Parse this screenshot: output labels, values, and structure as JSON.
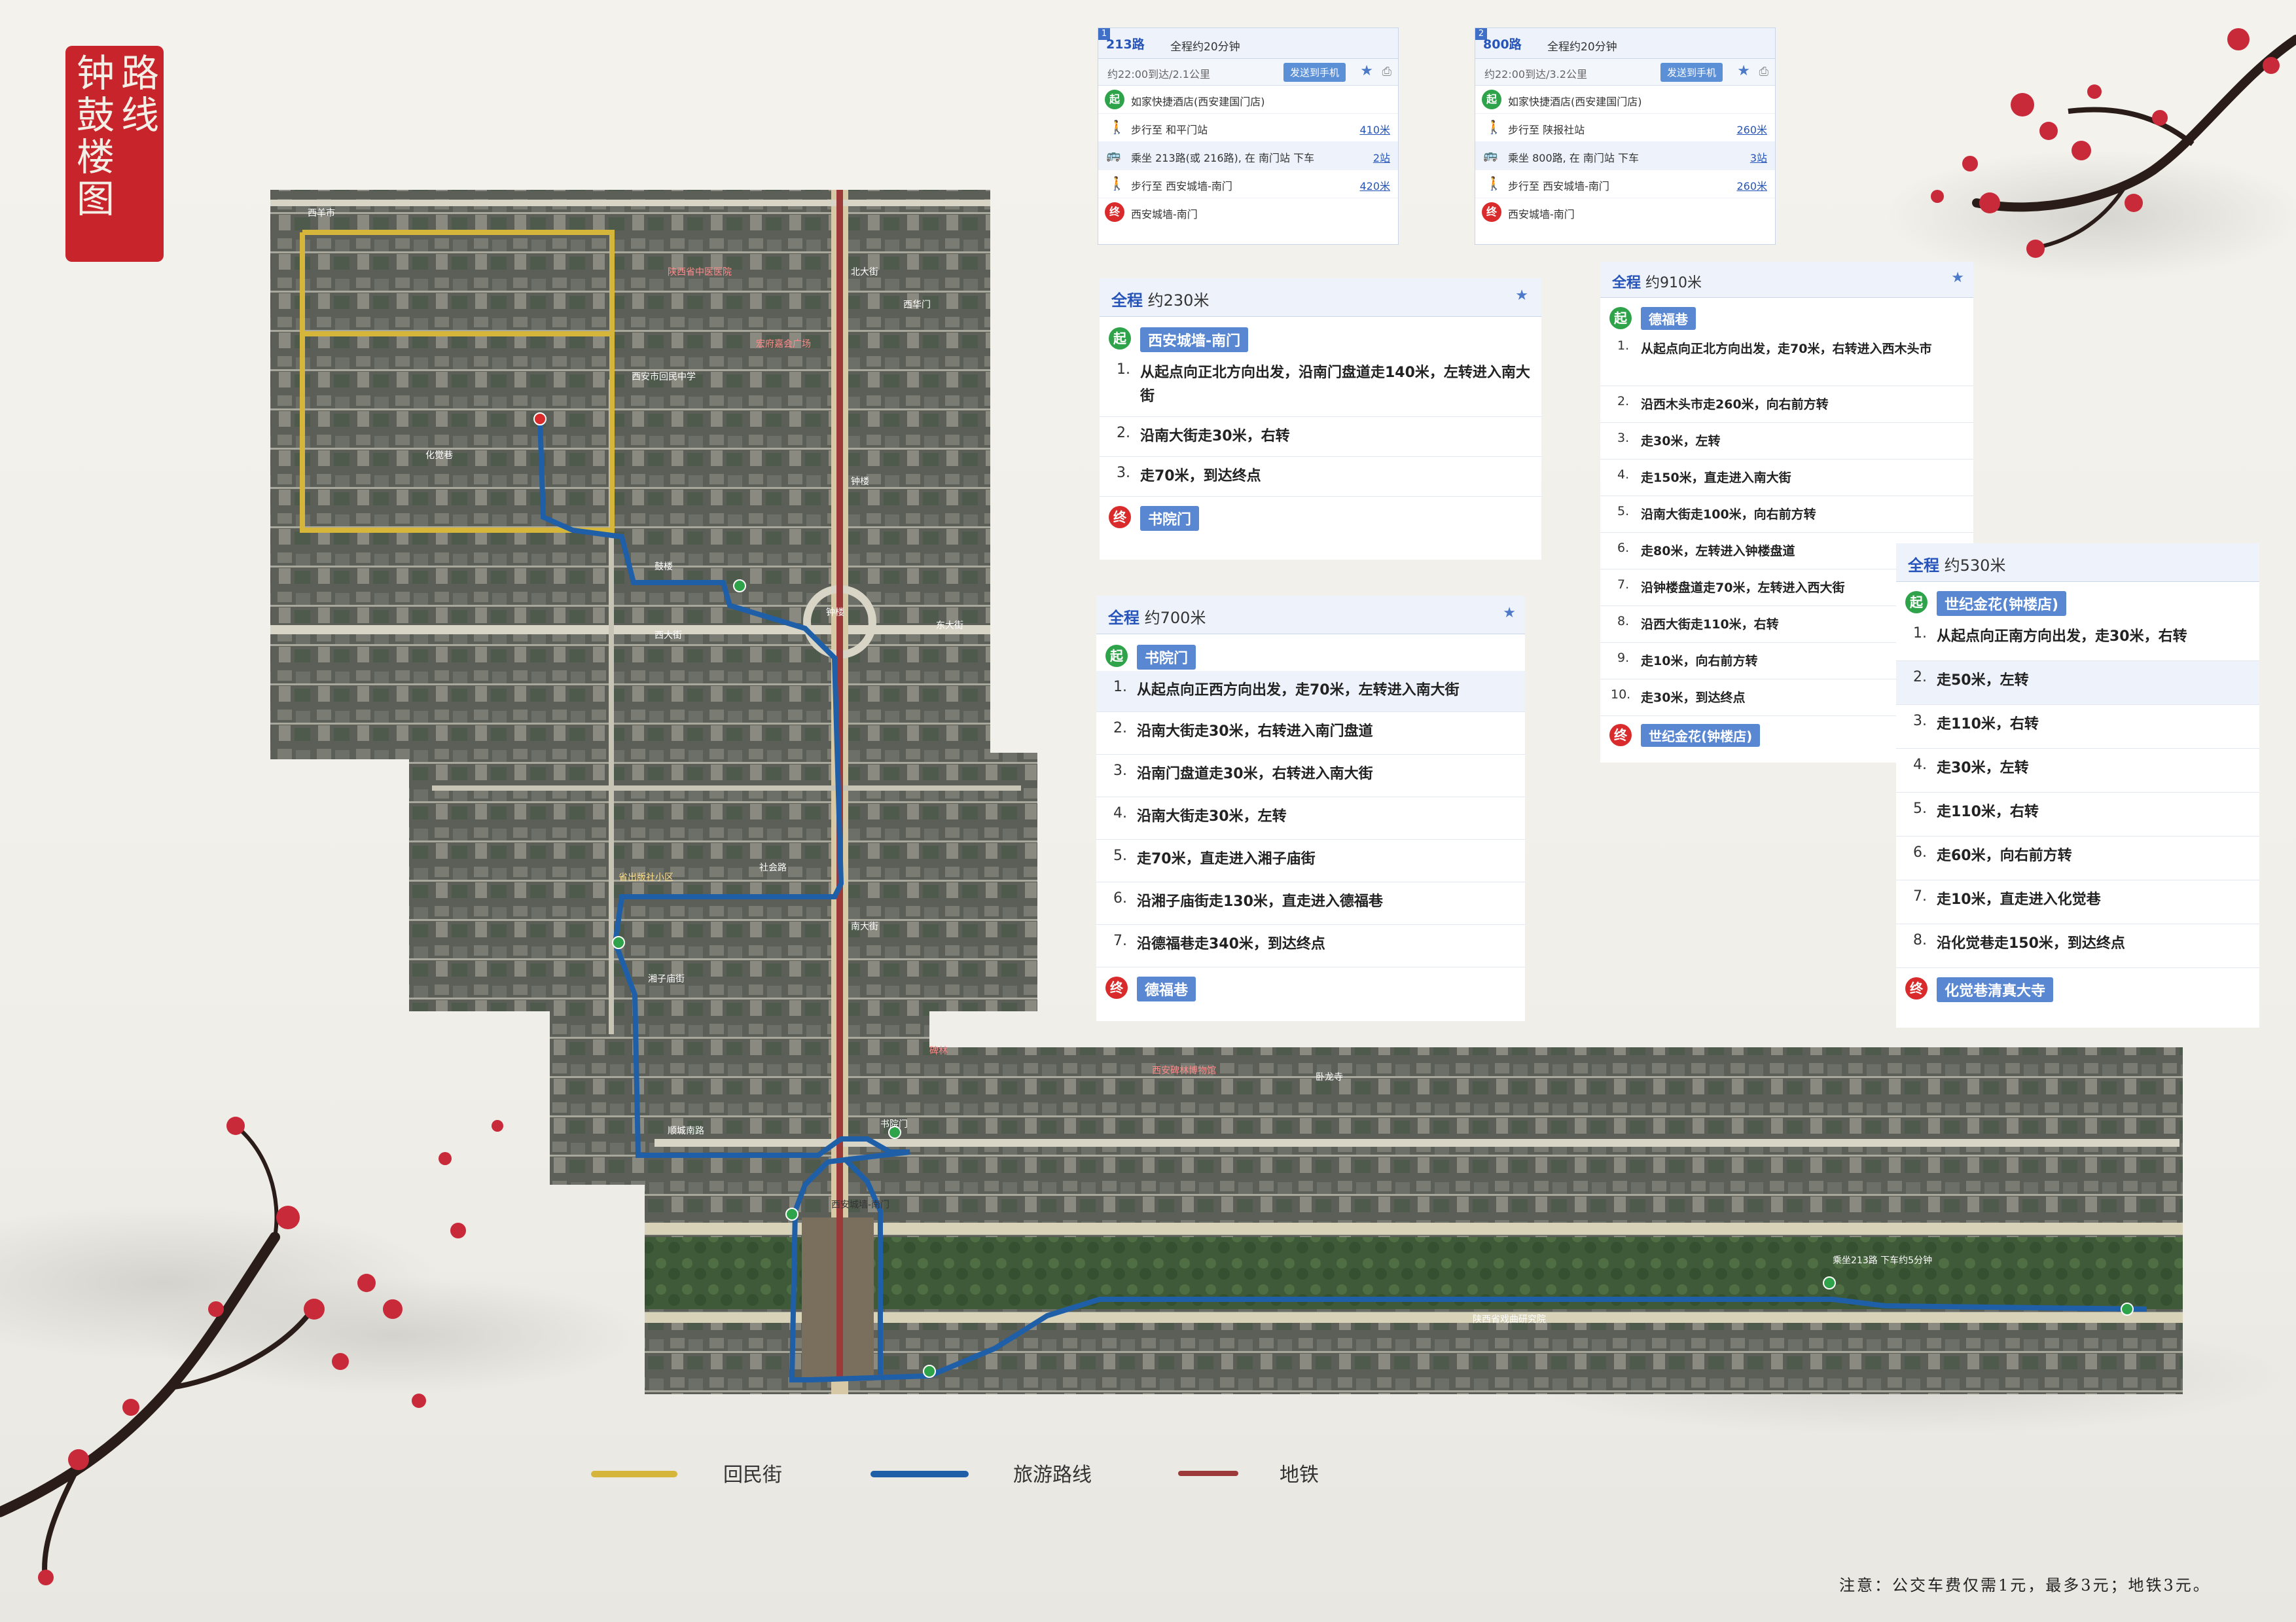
{
  "title": {
    "chars_right": [
      "路",
      "线"
    ],
    "chars_left": [
      "钟",
      "鼓",
      "楼",
      "图"
    ]
  },
  "map": {
    "labels": [
      "西羊市",
      "陕西省中医医院",
      "宏府嘉会广场",
      "钟楼",
      "西安市回民中学",
      "社会路",
      "湘子庙街",
      "西华门",
      "东大街",
      "西大街",
      "南大街",
      "北大街",
      "钟楼",
      "鼓楼",
      "书院门",
      "省出版社小区",
      "西安城墙-南门",
      "乘坐213路 下车约5分钟",
      "碑林",
      "顺城南路",
      "西安碑林博物馆",
      "陕西省戏曲研究院",
      "化觉巷",
      "卧龙寺"
    ],
    "colors": {
      "huimin": "#d6b63a",
      "tour": "#1f5fa8",
      "metro": "#9c3a3a"
    }
  },
  "bus1": {
    "idx": "1",
    "route": "213路",
    "total": "全程约20分钟",
    "sub": "约22:00到达/2.1公里",
    "send": "发送到手机",
    "rows": [
      {
        "icon": "起",
        "text": "如家快捷酒店(西安建国门店)",
        "dist": ""
      },
      {
        "icon": "walk",
        "text": "步行至 和平门站",
        "dist": "410米"
      },
      {
        "icon": "bus",
        "text": "乘坐 213路(或 216路), 在 南门站 下车",
        "dist": "2站"
      },
      {
        "icon": "walk",
        "text": "步行至 西安城墙-南门",
        "dist": "420米"
      },
      {
        "icon": "终",
        "text": "西安城墙-南门",
        "dist": ""
      }
    ]
  },
  "bus2": {
    "idx": "2",
    "route": "800路",
    "total": "全程约20分钟",
    "sub": "约22:00到达/3.2公里",
    "send": "发送到手机",
    "rows": [
      {
        "icon": "起",
        "text": "如家快捷酒店(西安建国门店)",
        "dist": ""
      },
      {
        "icon": "walk",
        "text": "步行至 陕报社站",
        "dist": "260米"
      },
      {
        "icon": "bus",
        "text": "乘坐 800路, 在 南门站 下车",
        "dist": "3站"
      },
      {
        "icon": "walk",
        "text": "步行至 西安城墙-南门",
        "dist": "260米"
      },
      {
        "icon": "终",
        "text": "西安城墙-南门",
        "dist": ""
      }
    ]
  },
  "route1": {
    "prefix": "全程",
    "dist": "约230米",
    "start": "西安城墙-南门",
    "end": "书院门",
    "steps": [
      "从起点向正北方向出发，沿南门盘道走140米，左转进入南大街",
      "沿南大街走30米，右转",
      "走70米，到达终点"
    ]
  },
  "route2": {
    "prefix": "全程",
    "dist": "约700米",
    "start": "书院门",
    "end": "德福巷",
    "steps": [
      "从起点向正西方向出发，走70米，左转进入南大街",
      "沿南大街走30米，右转进入南门盘道",
      "沿南门盘道走30米，右转进入南大街",
      "沿南大街走30米，左转",
      "走70米，直走进入湘子庙街",
      "沿湘子庙街走130米，直走进入德福巷",
      "沿德福巷走340米，到达终点"
    ]
  },
  "route3": {
    "prefix": "全程",
    "dist": "约910米",
    "start": "德福巷",
    "end": "世纪金花(钟楼店)",
    "steps": [
      "从起点向正北方向出发，走70米，右转进入西木头市",
      "沿西木头市走260米，向右前方转",
      "走30米，左转",
      "走150米，直走进入南大街",
      "沿南大街走100米，向右前方转",
      "走80米，左转进入钟楼盘道",
      "沿钟楼盘道走70米，左转进入西大街",
      "沿西大街走110米，右转",
      "走10米，向右前方转",
      "走30米，到达终点"
    ]
  },
  "route4": {
    "prefix": "全程",
    "dist": "约530米",
    "start": "世纪金花(钟楼店)",
    "end": "化觉巷清真大寺",
    "steps": [
      "从起点向正南方向出发，走30米，右转",
      "走50米，左转",
      "走110米，右转",
      "走30米，左转",
      "走110米，右转",
      "走60米，向右前方转",
      "走10米，直走进入化觉巷",
      "沿化觉巷走150米，到达终点"
    ]
  },
  "legend": {
    "huimin": "回民街",
    "tour": "旅游路线",
    "metro": "地铁"
  },
  "note": "注意：公交车费仅需1元，最多3元；地铁3元。"
}
